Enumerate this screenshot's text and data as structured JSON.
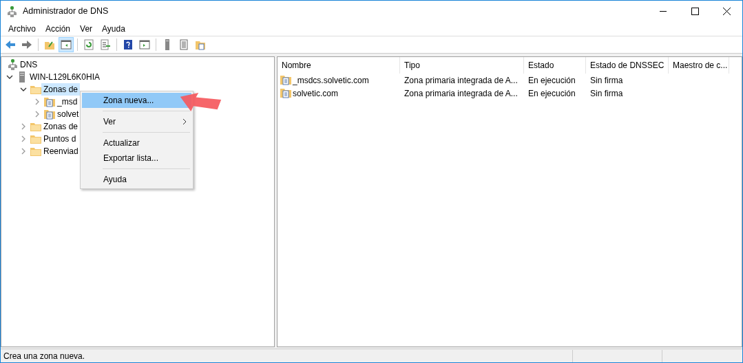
{
  "window": {
    "title": "Administrador de DNS"
  },
  "menu_bar": [
    "Archivo",
    "Acción",
    "Ver",
    "Ayuda"
  ],
  "toolbar": [
    {
      "kind": "back",
      "selected": false
    },
    {
      "kind": "forward",
      "selected": false
    },
    {
      "kind": "up",
      "selected": false
    },
    {
      "kind": "tree",
      "selected": true
    },
    {
      "kind": "refresh",
      "selected": false
    },
    {
      "kind": "export",
      "selected": false
    },
    {
      "kind": "help",
      "selected": false
    },
    {
      "kind": "action",
      "selected": false
    },
    {
      "kind": "server",
      "selected": false
    },
    {
      "kind": "list",
      "selected": false
    },
    {
      "kind": "folder",
      "selected": false
    }
  ],
  "tree": {
    "label": "DNS",
    "kind": "root",
    "selected": false,
    "children": [
      {
        "label": "WIN-L129L6K0HIA",
        "kind": "server",
        "expanded": true,
        "selected": false,
        "children": [
          {
            "label": "Zonas de",
            "kind": "folder",
            "expanded": true,
            "selected": true,
            "children": [
              {
                "label": "_msd",
                "kind": "zone",
                "expanded": false,
                "selected": false
              },
              {
                "label": "solvet",
                "kind": "zone",
                "expanded": false,
                "selected": false
              }
            ]
          },
          {
            "label": "Zonas de",
            "kind": "folder",
            "expanded": false,
            "selected": false
          },
          {
            "label": "Puntos d",
            "kind": "folder",
            "expanded": false,
            "selected": false
          },
          {
            "label": "Reenviad",
            "kind": "folder",
            "expanded": false,
            "selected": false
          }
        ]
      }
    ]
  },
  "context_menu": {
    "groups": [
      [
        {
          "label": "Zona nueva...",
          "selected": true,
          "submenu": false
        }
      ],
      [
        {
          "label": "Ver",
          "selected": false,
          "submenu": true
        }
      ],
      [
        {
          "label": "Actualizar",
          "selected": false,
          "submenu": false
        },
        {
          "label": "Exportar lista...",
          "selected": false,
          "submenu": false
        }
      ],
      [
        {
          "label": "Ayuda",
          "selected": false,
          "submenu": false
        }
      ]
    ]
  },
  "table": {
    "columns": [
      "Nombre",
      "Tipo",
      "Estado",
      "Estado de DNSSEC",
      "Maestro de c..."
    ],
    "rows": [
      [
        "_msdcs.solvetic.com",
        "Zona primaria integrada de A...",
        "En ejecución",
        "Sin firma"
      ],
      [
        "solvetic.com",
        "Zona primaria integrada de A...",
        "En ejecución",
        "Sin firma"
      ]
    ]
  },
  "status_bar": "Crea una zona nueva."
}
